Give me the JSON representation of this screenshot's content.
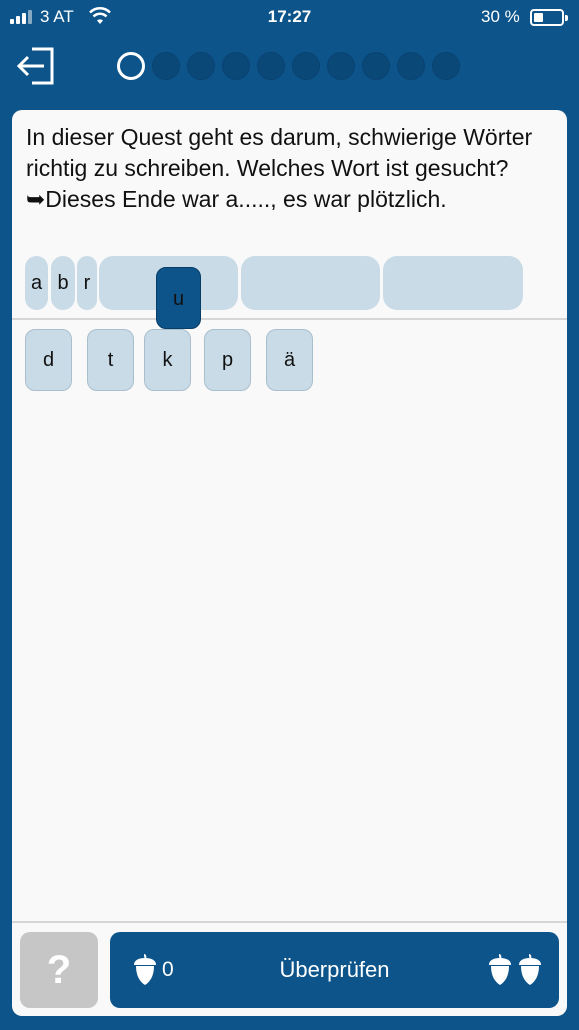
{
  "status_bar": {
    "carrier": "3 AT",
    "time": "17:27",
    "battery": "30 %",
    "battery_level": 0.3
  },
  "header": {
    "exit_icon": "exit-arrow-icon",
    "progress_total": 10,
    "progress_current": 1
  },
  "question": {
    "text": "In dieser Quest geht es darum, schwierige Wörter richtig zu schreiben. Welches Wort ist gesucht?  ➥Dieses Ende war a....., es war plötzlich."
  },
  "answer": {
    "placed_letters": [
      "a",
      "b",
      "r"
    ],
    "dragging_letter": "u"
  },
  "letter_choices": [
    "d",
    "t",
    "k",
    "p",
    "ä"
  ],
  "footer": {
    "help_label": "?",
    "acorn_count": "0",
    "check_label": "Überprüfen"
  },
  "colors": {
    "primary": "#0c5489",
    "tile": "#c9dbe7",
    "card": "#f9f9f9",
    "help_button": "#c6c6c6"
  }
}
